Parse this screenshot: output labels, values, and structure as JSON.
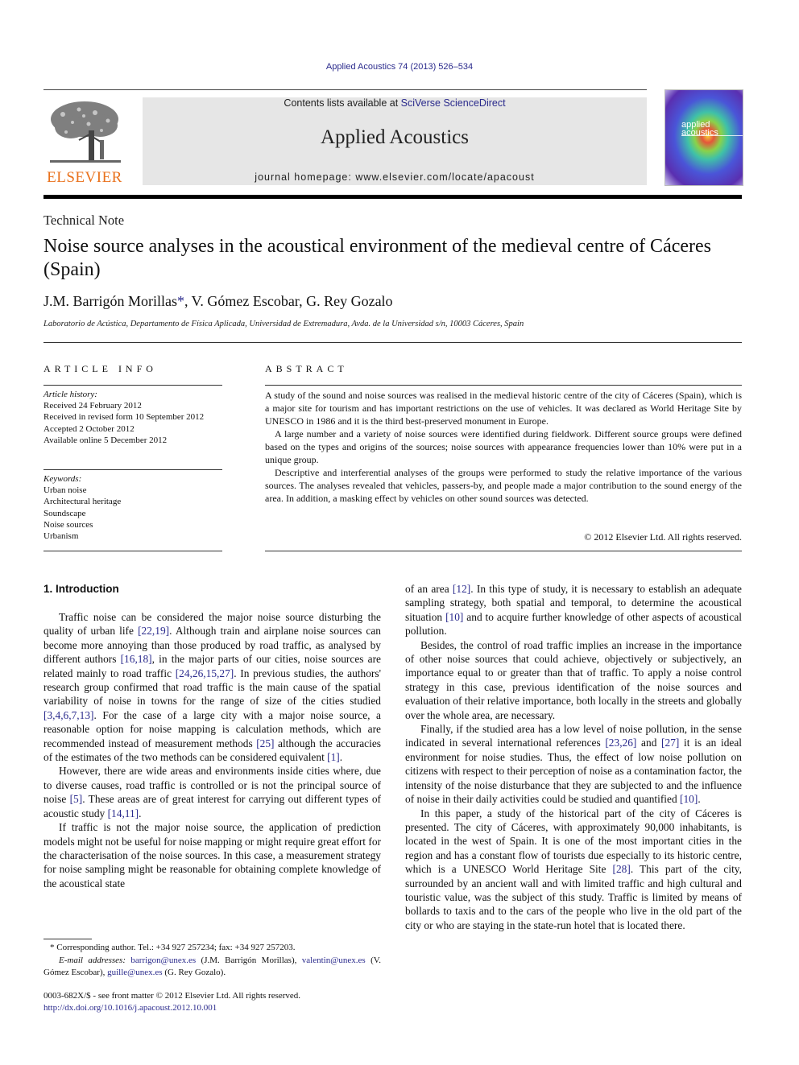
{
  "header": {
    "journal_ref": "Applied Acoustics 74 (2013) 526–534",
    "contents_prefix": "Contents lists available at ",
    "contents_link": "SciVerse ScienceDirect",
    "journal_title": "Applied Acoustics",
    "homepage": "journal homepage: www.elsevier.com/locate/apacoust",
    "publisher_logo_text": "ELSEVIER",
    "cover_text_line1": "applied",
    "cover_text_line2": "acoustics"
  },
  "article": {
    "type": "Technical Note",
    "title": "Noise source analyses in the acoustical environment of the medieval centre of Cáceres (Spain)",
    "authors": [
      {
        "name": "J.M. Barrigón Morillas",
        "mark": "*"
      },
      {
        "name": ", V. Gómez Escobar, G. Rey Gozalo",
        "mark": ""
      }
    ],
    "affiliation": "Laboratorio de Acústica, Departamento de Física Aplicada, Universidad de Extremadura, Avda. de la Universidad s/n, 10003 Cáceres, Spain"
  },
  "article_info": {
    "heading": "ARTICLE INFO",
    "history_label": "Article history:",
    "history": [
      "Received 24 February 2012",
      "Received in revised form 10 September 2012",
      "Accepted 2 October 2012",
      "Available online 5 December 2012"
    ],
    "keywords_label": "Keywords:",
    "keywords": [
      "Urban noise",
      "Architectural heritage",
      "Soundscape",
      "Noise sources",
      "Urbanism"
    ]
  },
  "abstract": {
    "heading": "ABSTRACT",
    "paragraphs": [
      "A study of the sound and noise sources was realised in the medieval historic centre of the city of Cáceres (Spain), which is a major site for tourism and has important restrictions on the use of vehicles. It was declared as World Heritage Site by UNESCO in 1986 and it is the third best-preserved monument in Europe.",
      "A large number and a variety of noise sources were identified during fieldwork. Different source groups were defined based on the types and origins of the sources; noise sources with appearance frequencies lower than 10% were put in a unique group.",
      "Descriptive and interferential analyses of the groups were performed to study the relative importance of the various sources. The analyses revealed that vehicles, passers-by, and people made a major contribution to the sound energy of the area. In addition, a masking effect by vehicles on other sound sources was detected."
    ],
    "copyright": "© 2012 Elsevier Ltd. All rights reserved."
  },
  "introduction": {
    "heading": "1. Introduction",
    "left_col": [
      [
        {
          "t": "Traffic noise can be considered the major noise source disturbing the quality of urban life "
        },
        {
          "r": "[22,19]"
        },
        {
          "t": ". Although train and airplane noise sources can become more annoying than those produced by road traffic, as analysed by different authors "
        },
        {
          "r": "[16,18]"
        },
        {
          "t": ", in the major parts of our cities, noise sources are related mainly to road traffic "
        },
        {
          "r": "[24,26,15,27]"
        },
        {
          "t": ". In previous studies, the authors' research group confirmed that road traffic is the main cause of the spatial variability of noise in towns for the range of size of the cities studied "
        },
        {
          "r": "[3,4,6,7,13]"
        },
        {
          "t": ". For the case of a large city with a major noise source, a reasonable option for noise mapping is calculation methods, which are recommended instead of measurement methods "
        },
        {
          "r": "[25]"
        },
        {
          "t": " although the accuracies of the estimates of the two methods can be considered equivalent "
        },
        {
          "r": "[1]"
        },
        {
          "t": "."
        }
      ],
      [
        {
          "t": "However, there are wide areas and environments inside cities where, due to diverse causes, road traffic is controlled or is not the principal source of noise "
        },
        {
          "r": "[5]"
        },
        {
          "t": ". These areas are of great interest for carrying out different types of acoustic study "
        },
        {
          "r": "[14,11]"
        },
        {
          "t": "."
        }
      ],
      [
        {
          "t": "If traffic is not the major noise source, the application of prediction models might not be useful for noise mapping or might require great effort for the characterisation of the noise sources. In this case, a measurement strategy for noise sampling might be reasonable for obtaining complete knowledge of the acoustical state"
        }
      ]
    ],
    "right_col": [
      [
        {
          "t": "of an area "
        },
        {
          "r": "[12]"
        },
        {
          "t": ". In this type of study, it is necessary to establish an adequate sampling strategy, both spatial and temporal, to determine the acoustical situation "
        },
        {
          "r": "[10]"
        },
        {
          "t": " and to acquire further knowledge of other aspects of acoustical pollution."
        }
      ],
      [
        {
          "t": "Besides, the control of road traffic implies an increase in the importance of other noise sources that could achieve, objectively or subjectively, an importance equal to or greater than that of traffic. To apply a noise control strategy in this case, previous identification of the noise sources and evaluation of their relative importance, both locally in the streets and globally over the whole area, are necessary."
        }
      ],
      [
        {
          "t": "Finally, if the studied area has a low level of noise pollution, in the sense indicated in several international references "
        },
        {
          "r": "[23,26]"
        },
        {
          "t": " and "
        },
        {
          "r": "[27]"
        },
        {
          "t": " it is an ideal environment for noise studies. Thus, the effect of low noise pollution on citizens with respect to their perception of noise as a contamination factor, the intensity of the noise disturbance that they are subjected to and the influence of noise in their daily activities could be studied and quantified "
        },
        {
          "r": "[10]"
        },
        {
          "t": "."
        }
      ],
      [
        {
          "t": "In this paper, a study of the historical part of the city of Cáceres is presented. The city of Cáceres, with approximately 90,000 inhabitants, is located in the west of Spain. It is one of the most important cities in the region and has a constant flow of tourists due especially to its historic centre, which is a UNESCO World Heritage Site "
        },
        {
          "r": "[28]"
        },
        {
          "t": ". This part of the city, surrounded by an ancient wall and with limited traffic and high cultural and touristic value, was the subject of this study. Traffic is limited by means of bollards to taxis and to the cars of the people who live in the old part of the city or who are staying in the state-run hotel that is located there."
        }
      ]
    ]
  },
  "footnote": {
    "star": "*",
    "corresponding": " Corresponding author. Tel.: +34 927 257234; fax: +34 927 257203.",
    "email_label": "E-mail addresses:",
    "emails": [
      {
        "addr": "barrigon@unex.es",
        "who": " (J.M. Barrigón Morillas), "
      },
      {
        "addr": "valentin@unex.es",
        "who": " (V. Gómez Escobar), "
      },
      {
        "addr": "guille@unex.es",
        "who": " (G. Rey Gozalo)."
      }
    ]
  },
  "front_matter": {
    "issn_line": "0003-682X/$ - see front matter © 2012 Elsevier Ltd. All rights reserved.",
    "doi": "http://dx.doi.org/10.1016/j.apacoust.2012.10.001"
  },
  "colors": {
    "link": "#2a2a8c",
    "elsevier_orange": "#e9711c",
    "banner_bg": "#e6e6e6"
  }
}
